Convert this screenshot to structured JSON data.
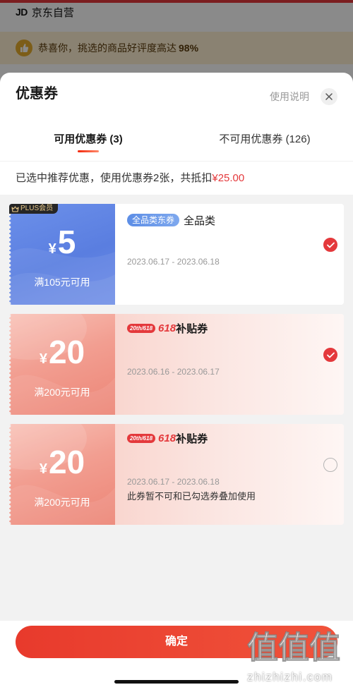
{
  "background_page": {
    "store_logo": "JD",
    "store_label": "京东自营",
    "banner_icon": "rating-badge-icon",
    "banner_text": "恭喜你，挑选的商品好评度高达",
    "banner_highlight": "98%"
  },
  "sheet": {
    "title": "优惠券",
    "help_label": "使用说明",
    "close_icon": "close-icon",
    "tabs": [
      {
        "label": "可用优惠券 (3)",
        "active": true
      },
      {
        "label": "不可用优惠券 (126)",
        "active": false
      }
    ],
    "summary": {
      "text": "已选中推荐优惠，使用优惠券2张，共抵扣",
      "amount": "¥25.00"
    },
    "coupons": [
      {
        "badge": "PLUS会员",
        "badge_icon": "crown-icon",
        "currency": "¥",
        "amount": "5",
        "condition": "满105元可用",
        "tag": "全品类东券",
        "name": "全品类",
        "date_range": "2023.06.17 - 2023.06.18",
        "selected": true
      },
      {
        "currency": "¥",
        "amount": "20",
        "condition": "满200元可用",
        "logo_badge": "20th/618",
        "title_highlight": "618",
        "title": "补贴券",
        "date_range": "2023.06.16 - 2023.06.17",
        "selected": true
      },
      {
        "currency": "¥",
        "amount": "20",
        "condition": "满200元可用",
        "logo_badge": "20th/618",
        "title_highlight": "618",
        "title": "补贴券",
        "date_range": "2023.06.17 - 2023.06.18",
        "note": "此券暂不可和已勾选券叠加使用",
        "selected": false
      }
    ]
  },
  "footer": {
    "confirm_label": "确定"
  },
  "watermark": {
    "mark": "值值值",
    "domain": "zhizhizhi.com"
  },
  "colors": {
    "accent": "#e4393c",
    "plus_blue": "#5f83e2",
    "subsidy_pink": "#f09b8e",
    "list_bg": "#f2f2f2"
  }
}
